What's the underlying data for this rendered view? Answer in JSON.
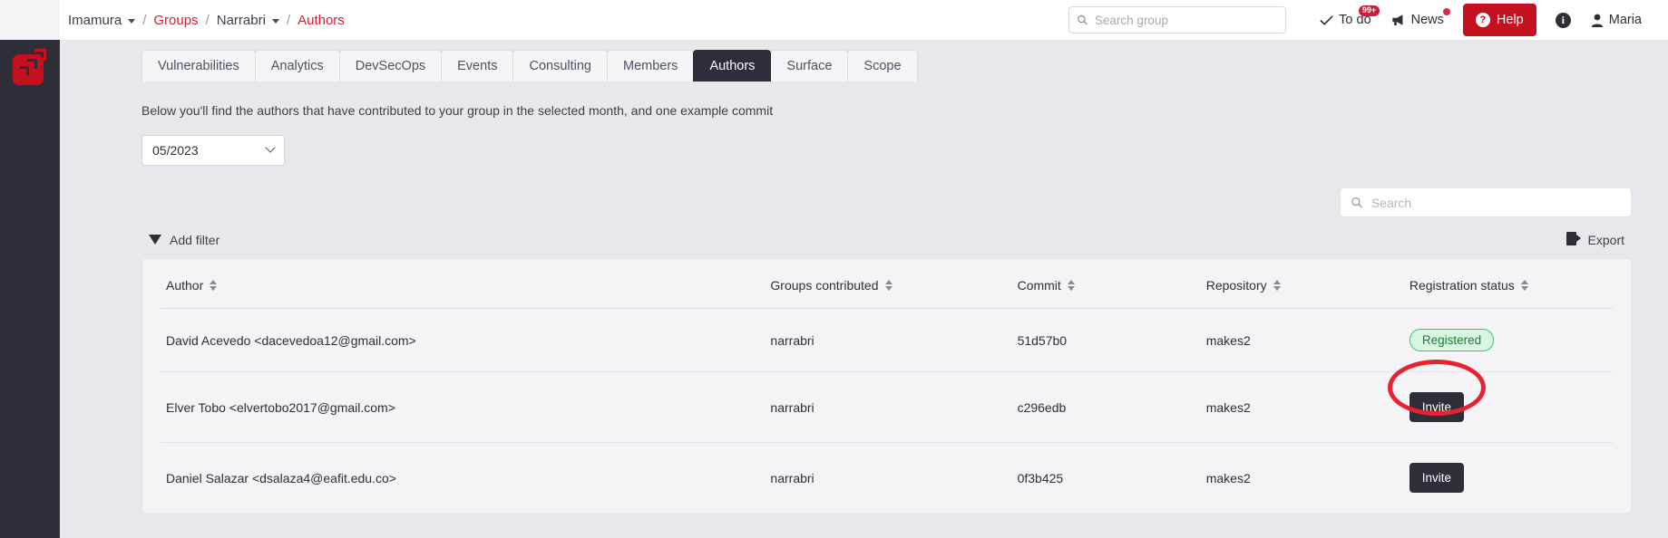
{
  "brand": {
    "logo_name": "app-logo",
    "accent": "#c4101f",
    "dark": "#2e2e38"
  },
  "breadcrumb": {
    "items": [
      {
        "label": "Imamura",
        "type": "dropdown"
      },
      {
        "label": "Groups",
        "type": "link"
      },
      {
        "label": "Narrabri",
        "type": "dropdown"
      },
      {
        "label": "Authors",
        "type": "link"
      }
    ],
    "separator": "/"
  },
  "header": {
    "search": {
      "placeholder": "Search group",
      "value": "",
      "icon": "search-icon"
    },
    "todo": {
      "label": "To do",
      "badge": "99+",
      "icon": "check-icon"
    },
    "news": {
      "label": "News",
      "icon": "megaphone-icon",
      "has_dot": true
    },
    "help": {
      "label": "Help",
      "icon": "question-circle-icon",
      "color": "#c4101f"
    },
    "info": {
      "icon": "info-icon"
    },
    "user": {
      "label": "Maria",
      "icon": "user-icon"
    }
  },
  "tabs": [
    {
      "label": "Vulnerabilities",
      "active": false
    },
    {
      "label": "Analytics",
      "active": false
    },
    {
      "label": "DevSecOps",
      "active": false
    },
    {
      "label": "Events",
      "active": false
    },
    {
      "label": "Consulting",
      "active": false
    },
    {
      "label": "Members",
      "active": false
    },
    {
      "label": "Authors",
      "active": true
    },
    {
      "label": "Surface",
      "active": false
    },
    {
      "label": "Scope",
      "active": false
    }
  ],
  "main": {
    "description": "Below you'll find the authors that have contributed to your group in the selected month, and one example commit",
    "month_select": {
      "value": "05/2023",
      "icon": "chevron-down-icon"
    },
    "table_search": {
      "placeholder": "Search",
      "value": "",
      "icon": "search-icon"
    },
    "add_filter": {
      "label": "Add filter",
      "icon": "funnel-icon"
    },
    "export": {
      "label": "Export",
      "icon": "file-export-icon"
    }
  },
  "table": {
    "columns": [
      {
        "label": "Author",
        "sortable": true
      },
      {
        "label": "Groups contributed",
        "sortable": true
      },
      {
        "label": "Commit",
        "sortable": true
      },
      {
        "label": "Repository",
        "sortable": true
      },
      {
        "label": "Registration status",
        "sortable": true
      }
    ],
    "rows": [
      {
        "author": "David Acevedo <dacevedoa12@gmail.com>",
        "groups": "narrabri",
        "commit": "51d57b0",
        "repository": "makes2",
        "status_type": "badge",
        "status_label": "Registered",
        "highlighted": false
      },
      {
        "author": "Elver Tobo <elvertobo2017@gmail.com>",
        "groups": "narrabri",
        "commit": "c296edb",
        "repository": "makes2",
        "status_type": "button",
        "status_label": "Invite",
        "highlighted": true
      },
      {
        "author": "Daniel Salazar <dsalaza4@eafit.edu.co>",
        "groups": "narrabri",
        "commit": "0f3b425",
        "repository": "makes2",
        "status_type": "button",
        "status_label": "Invite",
        "highlighted": false
      }
    ]
  },
  "annotation": {
    "shape": "ellipse",
    "color": "#e8232f",
    "target": "invite-button-row-2"
  }
}
